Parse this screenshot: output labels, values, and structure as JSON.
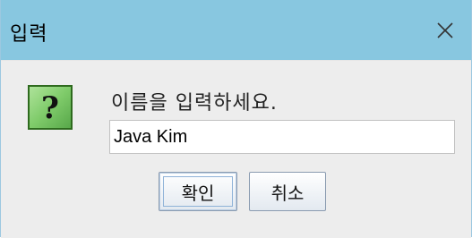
{
  "window": {
    "title": "입력",
    "close_icon": "close-icon"
  },
  "dialog": {
    "icon": "question-icon",
    "icon_glyph": "?",
    "prompt": "이름을 입력하세요.",
    "input_value": "Java Kim",
    "ok_label": "확인",
    "cancel_label": "취소"
  },
  "colors": {
    "titlebar": "#88c7e0",
    "background": "#ededed",
    "icon_green": "#7fcb6a"
  }
}
